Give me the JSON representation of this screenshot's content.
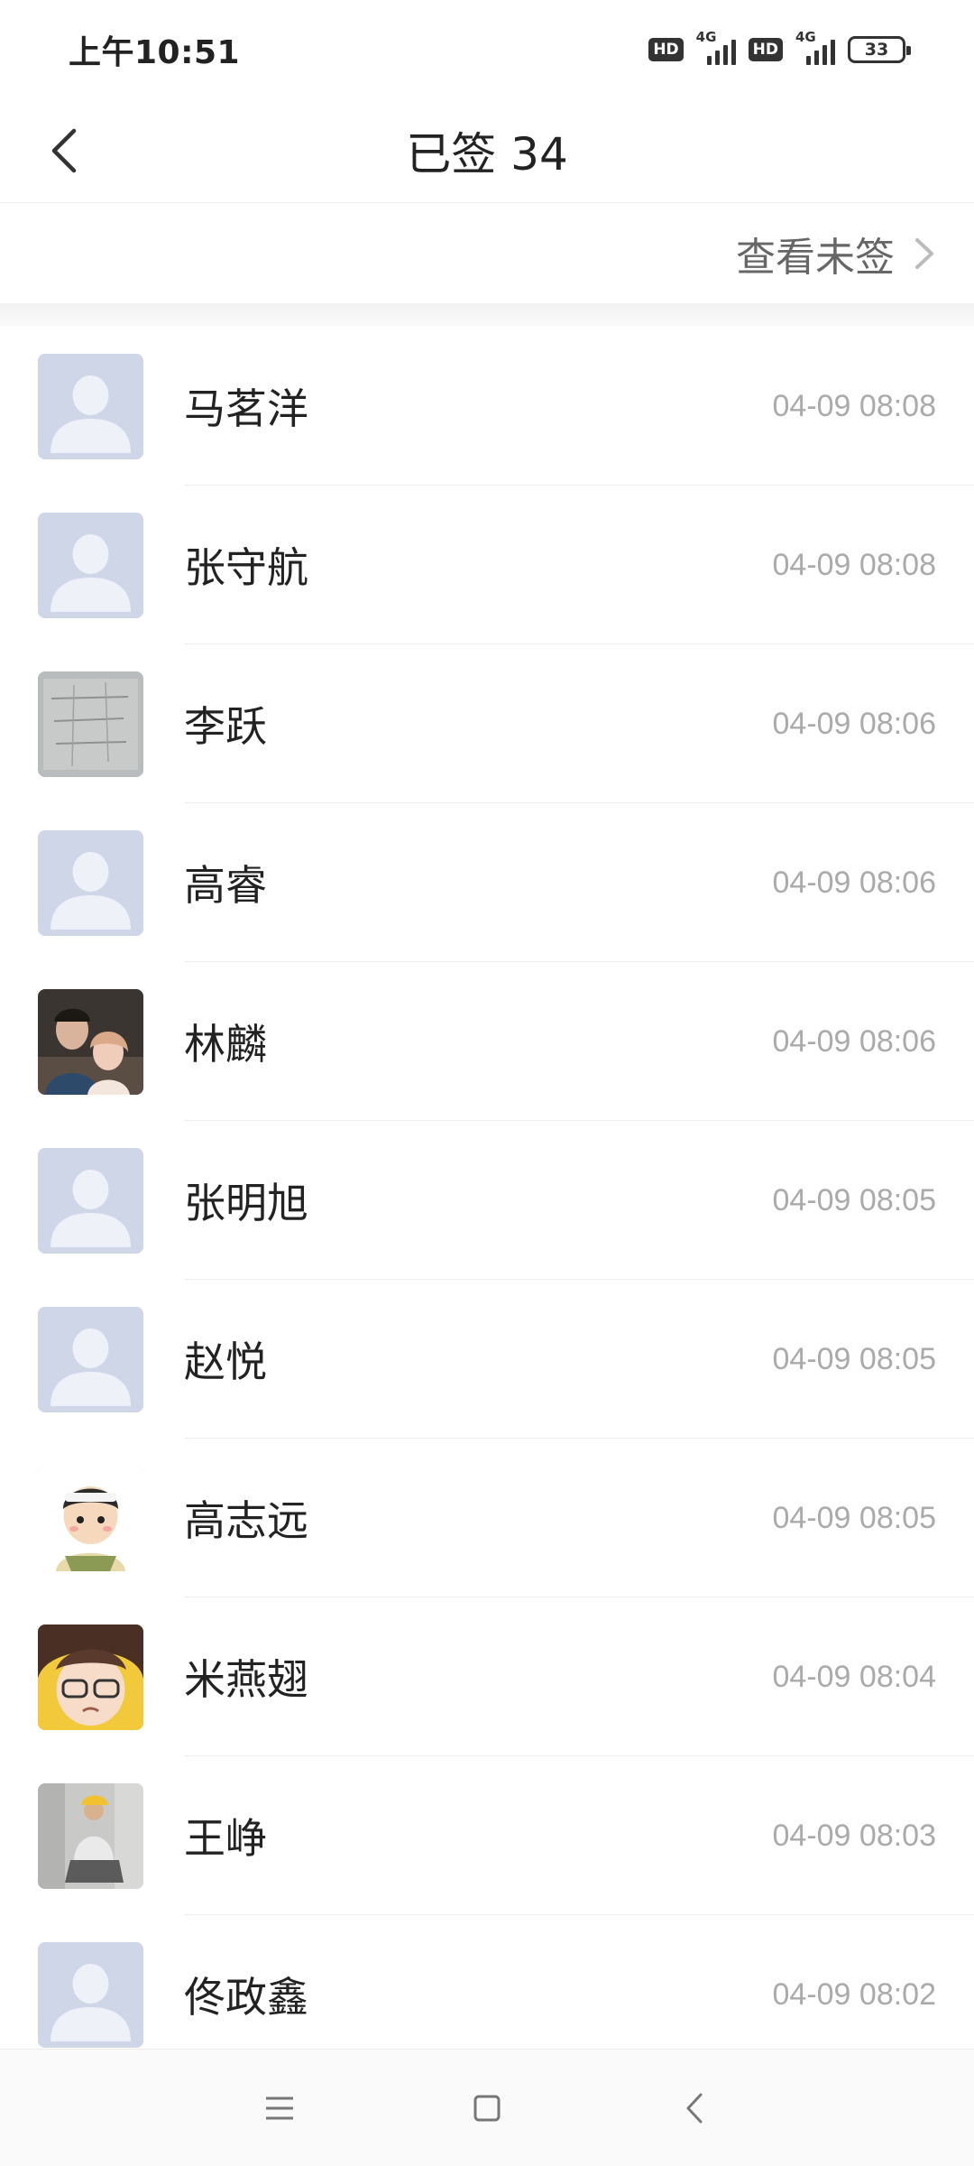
{
  "status_bar": {
    "time": "上午10:51",
    "hd1": "HD",
    "net1": "4G",
    "hd2": "HD",
    "net2": "4G",
    "battery": "33"
  },
  "header": {
    "title": "已签 34",
    "back_icon": "chevron-left-icon"
  },
  "unsigned_link": {
    "label": "查看未签",
    "icon": "chevron-right-icon"
  },
  "signed_list": [
    {
      "name": "马茗洋",
      "time": "04-09 08:08",
      "avatar": "default"
    },
    {
      "name": "张守航",
      "time": "04-09 08:08",
      "avatar": "default"
    },
    {
      "name": "李跃",
      "time": "04-09 08:06",
      "avatar": "photo-paper"
    },
    {
      "name": "高睿",
      "time": "04-09 08:06",
      "avatar": "default"
    },
    {
      "name": "林麟",
      "time": "04-09 08:06",
      "avatar": "photo-couple"
    },
    {
      "name": "张明旭",
      "time": "04-09 08:05",
      "avatar": "default"
    },
    {
      "name": "赵悦",
      "time": "04-09 08:05",
      "avatar": "default"
    },
    {
      "name": "高志远",
      "time": "04-09 08:05",
      "avatar": "cartoon-boy"
    },
    {
      "name": "米燕翅",
      "time": "04-09 08:04",
      "avatar": "anime-glasses"
    },
    {
      "name": "王峥",
      "time": "04-09 08:03",
      "avatar": "photo-person"
    },
    {
      "name": "佟政鑫",
      "time": "04-09 08:02",
      "avatar": "default"
    }
  ],
  "system_nav": {
    "menu_icon": "menu-icon",
    "home_icon": "home-square-icon",
    "back_icon": "back-triangle-icon"
  },
  "colors": {
    "default_avatar_bg": "#cfd6e8",
    "default_avatar_fg": "#eef1f8",
    "time_text": "#aaaaaa"
  }
}
